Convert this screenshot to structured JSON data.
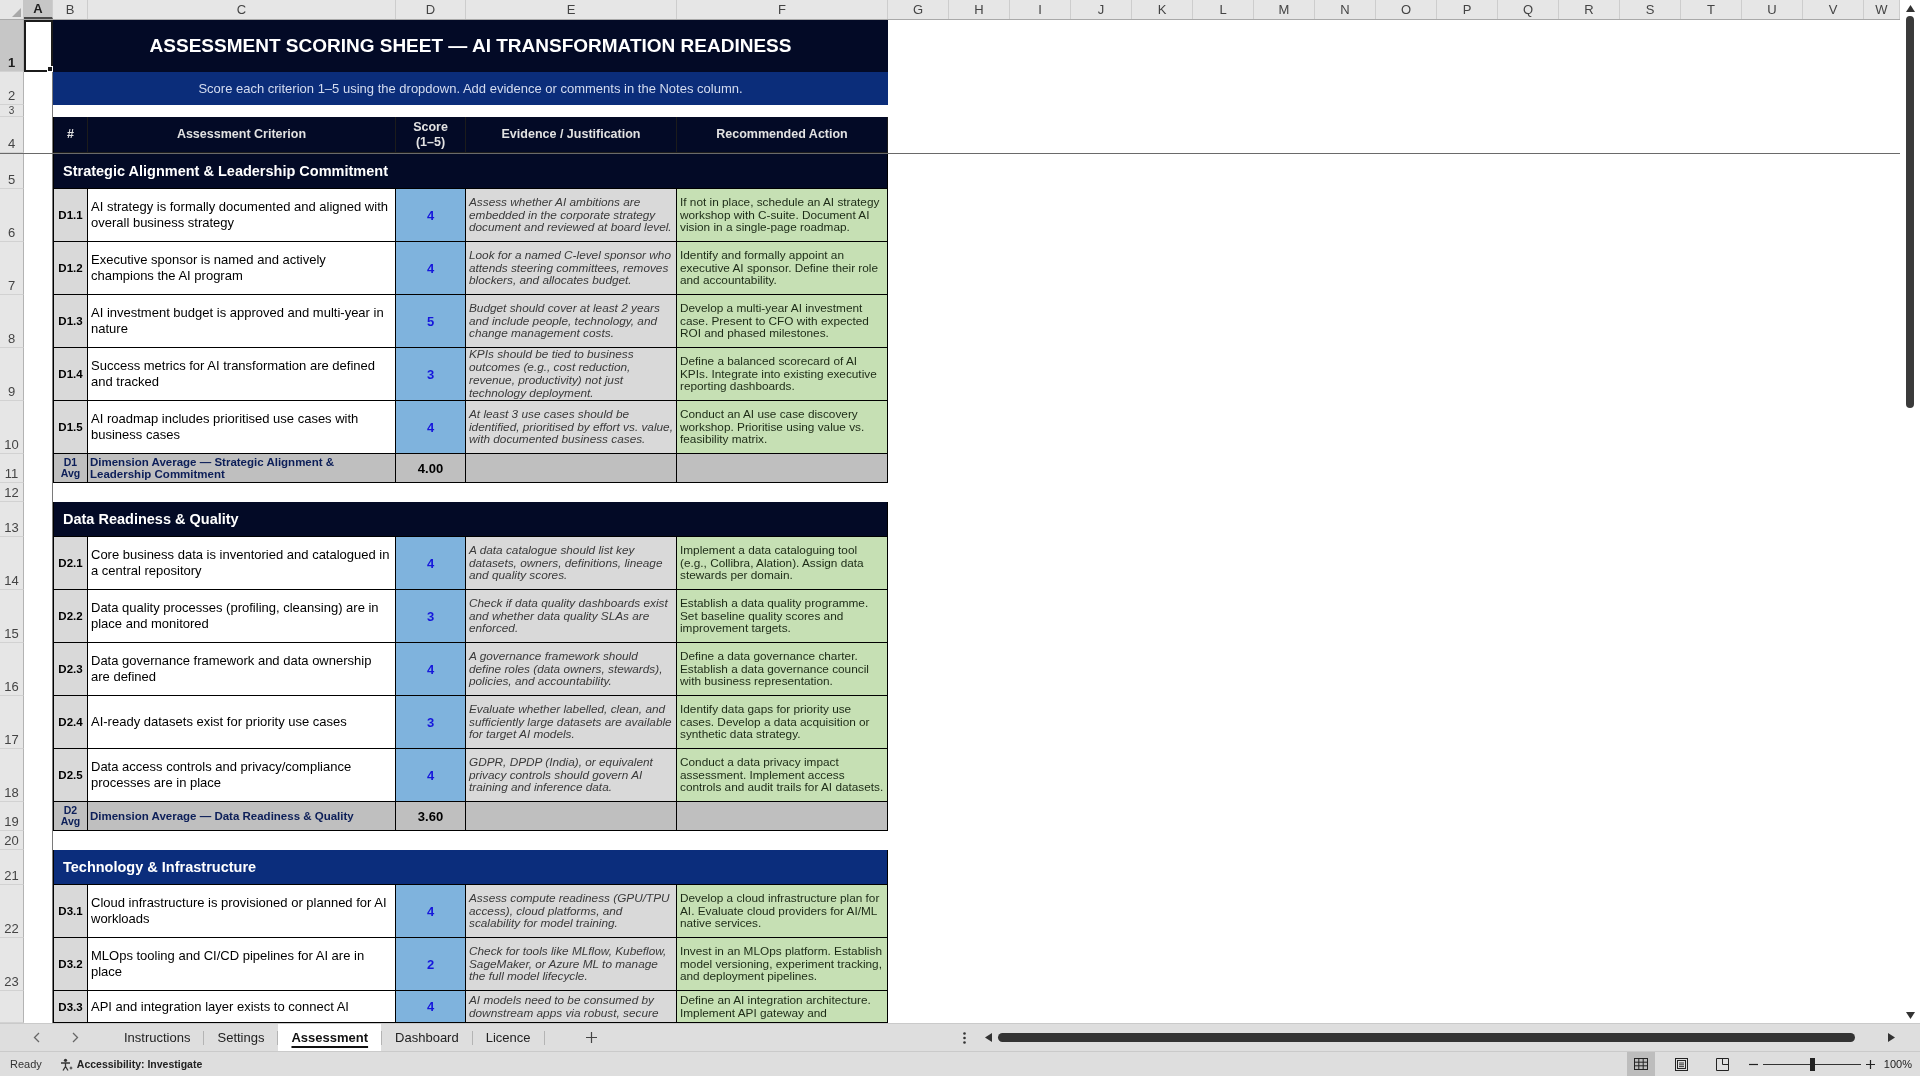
{
  "spreadsheet": {
    "column_headers": [
      {
        "label": "A",
        "selected": true
      },
      {
        "label": "B",
        "selected": false
      },
      {
        "label": "C",
        "selected": false
      },
      {
        "label": "D",
        "selected": false
      },
      {
        "label": "E",
        "selected": false
      },
      {
        "label": "F",
        "selected": false
      },
      {
        "label": "G",
        "selected": false
      },
      {
        "label": "H",
        "selected": false
      },
      {
        "label": "I",
        "selected": false
      },
      {
        "label": "J",
        "selected": false
      },
      {
        "label": "K",
        "selected": false
      },
      {
        "label": "L",
        "selected": false
      },
      {
        "label": "M",
        "selected": false
      },
      {
        "label": "N",
        "selected": false
      },
      {
        "label": "O",
        "selected": false
      },
      {
        "label": "P",
        "selected": false
      },
      {
        "label": "Q",
        "selected": false
      },
      {
        "label": "R",
        "selected": false
      },
      {
        "label": "S",
        "selected": false
      },
      {
        "label": "T",
        "selected": false
      },
      {
        "label": "U",
        "selected": false
      },
      {
        "label": "V",
        "selected": false
      },
      {
        "label": "W",
        "selected": false
      }
    ],
    "row_headers": [
      {
        "label": "1",
        "selected": true
      },
      {
        "label": "2",
        "selected": false
      },
      {
        "label": "3",
        "selected": false
      },
      {
        "label": "4",
        "selected": false
      },
      {
        "label": "5",
        "selected": false
      },
      {
        "label": "6",
        "selected": false
      },
      {
        "label": "7",
        "selected": false
      },
      {
        "label": "8",
        "selected": false
      },
      {
        "label": "9",
        "selected": false
      },
      {
        "label": "10",
        "selected": false
      },
      {
        "label": "11",
        "selected": false
      },
      {
        "label": "12",
        "selected": false
      },
      {
        "label": "13",
        "selected": false
      },
      {
        "label": "14",
        "selected": false
      },
      {
        "label": "15",
        "selected": false
      },
      {
        "label": "16",
        "selected": false
      },
      {
        "label": "17",
        "selected": false
      },
      {
        "label": "18",
        "selected": false
      },
      {
        "label": "19",
        "selected": false
      },
      {
        "label": "20",
        "selected": false
      },
      {
        "label": "21",
        "selected": false
      },
      {
        "label": "22",
        "selected": false
      },
      {
        "label": "23",
        "selected": false
      }
    ]
  },
  "sheet": {
    "title": "ASSESSMENT SCORING SHEET — AI TRANSFORMATION READINESS",
    "instruction": "Score each criterion 1–5 using the dropdown. Add evidence or comments in the Notes column.",
    "table_header": [
      "#",
      "Assessment Criterion",
      "Score (1–5)",
      "Evidence / Justification",
      "Recommended Action"
    ],
    "sections": [
      {
        "title": "Strategic Alignment & Leadership Commitment",
        "color": "#030a26",
        "items": [
          {
            "id": "D1.1",
            "criterion": "AI strategy is formally documented and aligned with overall business strategy",
            "score": "4",
            "evidence": "Assess whether AI ambitions are embedded in the corporate strategy document and reviewed at board level.",
            "action": "If not in place, schedule an AI strategy workshop with C-suite. Document AI vision in a single-page roadmap."
          },
          {
            "id": "D1.2",
            "criterion": "Executive sponsor is named and actively champions the AI program",
            "score": "4",
            "evidence": "Look for a named C-level sponsor who attends steering committees, removes blockers, and allocates budget.",
            "action": "Identify and formally appoint an executive AI sponsor. Define their role and accountability."
          },
          {
            "id": "D1.3",
            "criterion": "AI investment budget is approved and multi-year in nature",
            "score": "5",
            "evidence": "Budget should cover at least 2 years and include people, technology, and change management costs.",
            "action": "Develop a multi-year AI investment case. Present to CFO with expected ROI and phased milestones."
          },
          {
            "id": "D1.4",
            "criterion": "Success metrics for AI transformation are defined and tracked",
            "score": "3",
            "evidence": "KPIs should be tied to business outcomes (e.g., cost reduction, revenue, productivity) not just technology deployment.",
            "action": "Define a balanced scorecard of AI KPIs. Integrate into existing executive reporting dashboards."
          },
          {
            "id": "D1.5",
            "criterion": "AI roadmap includes prioritised use cases with business cases",
            "score": "4",
            "evidence": "At least 3 use cases should be identified, prioritised by effort vs. value, with documented business cases.",
            "action": "Conduct an AI use case discovery workshop. Prioritise using value vs. feasibility matrix."
          }
        ],
        "average": {
          "id": "D1 Avg",
          "label": "Dimension Average — Strategic Alignment & Leadership Commitment",
          "value": "4.00"
        }
      },
      {
        "title": "Data Readiness & Quality",
        "color": "#030a26",
        "items": [
          {
            "id": "D2.1",
            "criterion": "Core business data is inventoried and catalogued in a central repository",
            "score": "4",
            "evidence": "A data catalogue should list key datasets, owners, definitions, lineage and quality scores.",
            "action": "Implement a data cataloguing tool (e.g., Collibra, Alation). Assign data stewards per domain."
          },
          {
            "id": "D2.2",
            "criterion": "Data quality processes (profiling, cleansing) are in place and monitored",
            "score": "3",
            "evidence": "Check if data quality dashboards exist and whether data quality SLAs are enforced.",
            "action": "Establish a data quality programme. Set baseline quality scores and improvement targets."
          },
          {
            "id": "D2.3",
            "criterion": "Data governance framework and data ownership are defined",
            "score": "4",
            "evidence": "A governance framework should define roles (data owners, stewards), policies, and accountability.",
            "action": "Define a data governance charter. Establish a data governance council with business representation."
          },
          {
            "id": "D2.4",
            "criterion": "AI-ready datasets exist for priority use cases",
            "score": "3",
            "evidence": "Evaluate whether labelled, clean, and sufficiently large datasets are available for target AI models.",
            "action": "Identify data gaps for priority use cases. Develop a data acquisition or synthetic data strategy."
          },
          {
            "id": "D2.5",
            "criterion": "Data access controls and privacy/compliance processes are in place",
            "score": "4",
            "evidence": "GDPR, DPDP (India), or equivalent privacy controls should govern AI training and inference data.",
            "action": "Conduct a data privacy impact assessment. Implement access controls and audit trails for AI datasets."
          }
        ],
        "average": {
          "id": "D2 Avg",
          "label": "Dimension Average — Data Readiness & Quality",
          "value": "3.60"
        }
      },
      {
        "title": "Technology & Infrastructure",
        "color": "#0b2d7c",
        "items": [
          {
            "id": "D3.1",
            "criterion": "Cloud infrastructure is provisioned or planned for AI workloads",
            "score": "4",
            "evidence": "Assess compute readiness (GPU/TPU access), cloud platforms, and scalability for model training.",
            "action": "Develop a cloud infrastructure plan for AI. Evaluate cloud providers for AI/ML native services."
          },
          {
            "id": "D3.2",
            "criterion": "MLOps tooling and CI/CD pipelines for AI are in place",
            "score": "2",
            "evidence": "Check for tools like MLflow, Kubeflow, SageMaker, or Azure ML to manage the full model lifecycle.",
            "action": "Invest in an MLOps platform. Establish model versioning, experiment tracking, and deployment pipelines."
          },
          {
            "id": "D3.3",
            "criterion": "API and integration layer exists to connect AI",
            "score": "4",
            "evidence": "AI models need to be consumed by downstream apps via robust, secure",
            "action": "Define an AI integration architecture. Implement API gateway and"
          }
        ]
      }
    ]
  },
  "sheet_tabs": [
    {
      "label": "Instructions",
      "selected": false
    },
    {
      "label": "Settings",
      "selected": false
    },
    {
      "label": "Assessment",
      "selected": true
    },
    {
      "label": "Dashboard",
      "selected": false
    },
    {
      "label": "Licence",
      "selected": false
    }
  ],
  "status_bar": {
    "status": "Ready",
    "accessibility": "Accessibility: Investigate",
    "view_buttons": [
      {
        "kind": "normal",
        "selected": true
      },
      {
        "kind": "page_layout",
        "selected": false
      },
      {
        "kind": "page_break_preview",
        "selected": false
      }
    ],
    "zoom": {
      "level": 0.5,
      "label": "100%"
    }
  }
}
